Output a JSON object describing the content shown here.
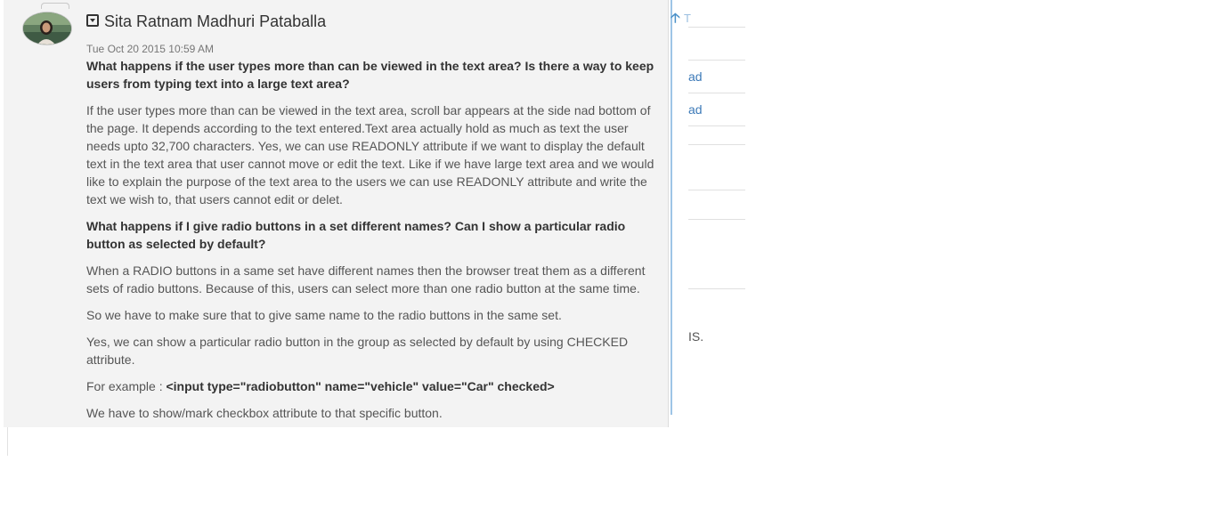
{
  "background": {
    "up_text": "T",
    "links": [
      "ad",
      "ad"
    ],
    "text": "IS.",
    "colors": {
      "link": "#3d7ab8",
      "scroll_line": "#9ec5e6"
    }
  },
  "comment": {
    "author": "Sita Ratnam Madhuri Pataballa",
    "timestamp": "Tue Oct 20 2015 10:59 AM",
    "toggle_icon": "collapse-toggle-icon",
    "paragraphs": {
      "q1": "What happens if the user types more than can be viewed in the text area? Is there a way to keep users from typing text into a large text area?",
      "a1": "If the user types more than can be viewed in the text area, scroll bar appears at the side nad bottom of the page. It depends according to the text entered.Text area actually hold as much as text the user needs upto 32,700 characters. Yes, we can use READONLY attribute if we want to display the default text in the text area that user cannot move or edit the text. Like if we have large text area and we would like to explain the purpose of the text area to the users we can use READONLY attribute and write the text we wish to, that users cannot edit or delet.",
      "q2": "What happens if I give radio buttons in a set different names? Can I show a particular radio button as selected by default?",
      "a2": "When a RADIO buttons in a same set have different names then the browser treat them as a different sets of radio buttons. Because of this, users can select more than one radio button at the same time.",
      "a3": "So we have to make sure that to give same name to the radio buttons in the same set.",
      "a4": "Yes, we can show a particular radio button in the group as selected by default by using CHECKED attribute.",
      "example_prefix": "For example : ",
      "example_code": "<input type=\"radiobutton\" name=\"vehicle\" value=\"Car\" checked>",
      "cut_off": "We have to show/mark checkbox attribute to that specific button."
    }
  }
}
